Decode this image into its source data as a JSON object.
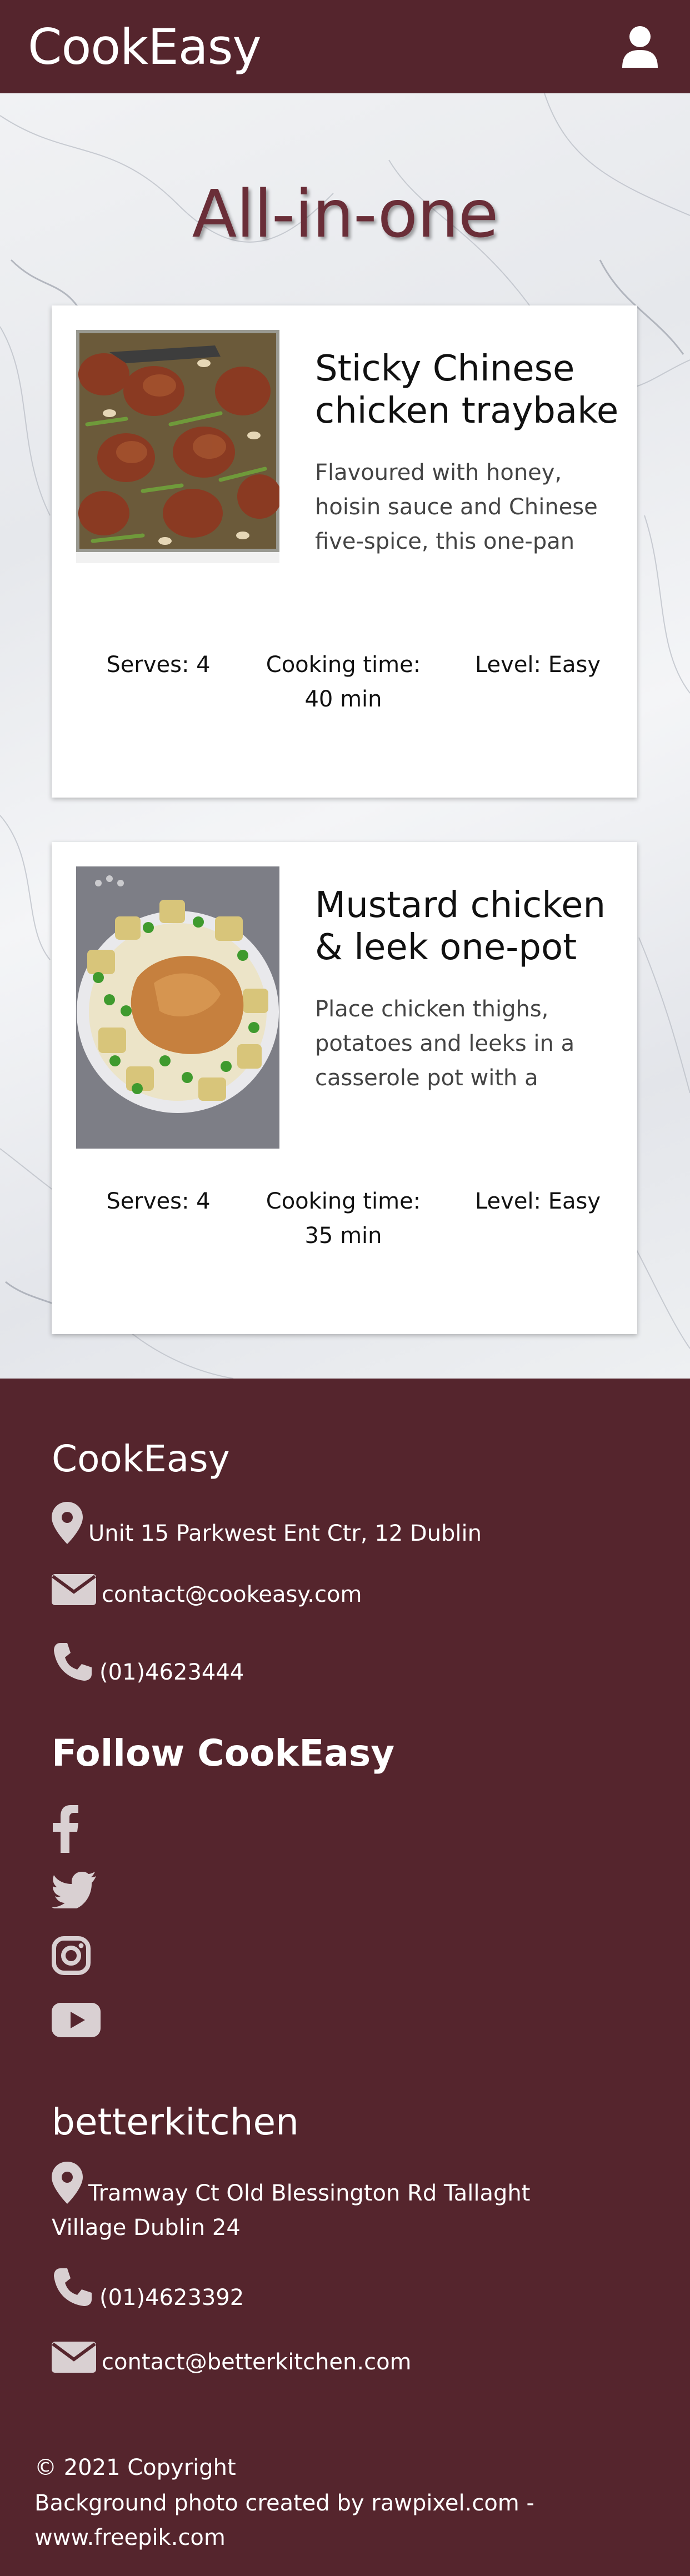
{
  "header": {
    "brand": "CookEasy",
    "user_icon": "user-icon"
  },
  "page_title": "All-in-one",
  "recipes": [
    {
      "title": "Sticky Chinese chicken traybake",
      "description": "Flavoured with honey, hoisin sauce and Chinese five-spice, this one-pan chicken...",
      "serves": "Serves: 4",
      "time_label": "Cooking time:",
      "time_value": "40 min",
      "level": "Level: Easy"
    },
    {
      "title": "Mustard chicken & leek one-pot",
      "description": "Place chicken thighs, potatoes and leeks in a casserole pot with a musta...",
      "serves": "Serves: 4",
      "time_label": "Cooking time:",
      "time_value": "35 min",
      "level": "Level: Easy"
    }
  ],
  "footer": {
    "brand1": "CookEasy",
    "address1": "Unit 15 Parkwest Ent Ctr, 12 Dublin",
    "email1": "contact@cookeasy.com",
    "phone1": "(01)4623444",
    "follow_title": "Follow CookEasy",
    "social_icons": [
      "facebook-icon",
      "twitter-icon",
      "instagram-icon",
      "youtube-icon"
    ],
    "brand2": "betterkitchen",
    "address2": "Tramway Ct Old Blessington Rd Tallaght Village Dublin 24",
    "phone2": "(01)4623392",
    "email2": "contact@betterkitchen.com",
    "copyright": "© 2021 Copyright",
    "credit": "Background photo created by rawpixel.com - www.freepik.com"
  },
  "colors": {
    "brand": "#55252d",
    "title": "#6a2e38",
    "icon_gray": "#d9d0d2"
  }
}
